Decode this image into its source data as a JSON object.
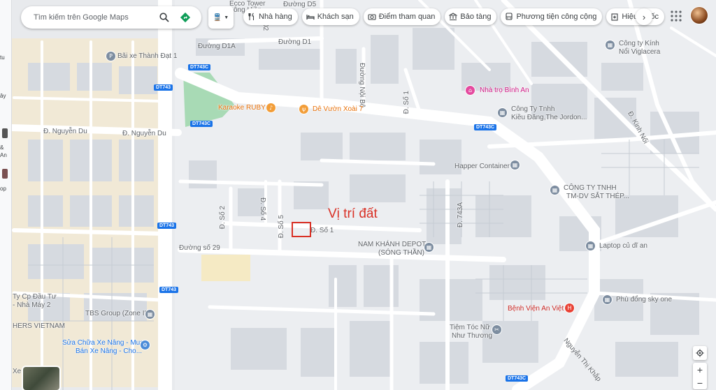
{
  "search": {
    "placeholder": "Tìm kiếm trên Google Maps"
  },
  "chips": [
    {
      "label": "Nhà hàng",
      "icon": "fork-knife-icon"
    },
    {
      "label": "Khách sạn",
      "icon": "bed-icon"
    },
    {
      "label": "Điểm tham quan",
      "icon": "camera-icon"
    },
    {
      "label": "Bảo tàng",
      "icon": "museum-icon"
    },
    {
      "label": "Phương tiện công cộng",
      "icon": "bus-icon"
    },
    {
      "label": "Hiệu thuốc",
      "icon": "pharmacy-icon"
    }
  ],
  "overlay": {
    "title": "Vị trí đất"
  },
  "left_strip_text": [
    "tu",
    "ây",
    "&",
    "An",
    "op"
  ],
  "streets": {
    "nguyen_du_1": "Đ. Nguyễn Du",
    "nguyen_du_2": "Đ. Nguyễn Du",
    "d1a": "Đường D1A",
    "d1": "Đường D1",
    "d5": "Đường D5",
    "d2": "02",
    "noi_bo": "Đường Nội Bộ",
    "so1_top": "Đ. Số 1",
    "so1": "Đ. Số 1",
    "so2": "Đ. Số 2",
    "so4": "Đ. Số 4",
    "so5": "Đ. Số 5",
    "so29": "Đường số 29",
    "d743a": "Đ. 743A",
    "kinh_noi": "Đ. Kinh Nối",
    "nguyen_thi_khap": "Nguyễn Thị Khắp"
  },
  "shields": {
    "dt743c_1": "DT743C",
    "dt743": "DT743",
    "dt743c_2": "DT743C",
    "dt743c_3": "DT743C",
    "dt743_2": "DT743",
    "dt743_3": "DT743",
    "dt743c_4": "DT743C"
  },
  "places": {
    "ecco_tower": "Ecco Tower",
    "cong_hien": "ông Hiền",
    "bai_xe": "Bãi xe Thành Đạt 1",
    "karaoke": "Karaoke RUBY",
    "de_vuon": "Dê Vườn Xoài 7",
    "nha_tro": "Nhà trọ Bình An",
    "kinh_noi_viglacera_1": "Công ty Kính",
    "kinh_noi_viglacera_2": "Nổi Viglacera",
    "kieu_dang_1": "Công Ty Tnhh",
    "kieu_dang_2": "Kiều Đăng,The Jordon...",
    "happer": "Happer Container",
    "sat_thep_1": "CÔNG TY TNHH",
    "sat_thep_2": "TM-DV SẮT THÉP...",
    "nam_khanh_1": "NAM KHÁNH DEPOT",
    "nam_khanh_2": "(SÓNG THẦN)",
    "laptop": "Laptop củ dĩ an",
    "phu_dong": "Phù đổng sky one",
    "benh_vien": "Bệnh Viện An Việt",
    "tiem_toc_1": "Tiệm Tóc Nữ",
    "tiem_toc_2": "Như Thương",
    "tbs": "TBS Group (Zone II)",
    "ty_cp_1": "Ty Cp Đầu Tư",
    "ty_cp_2": "- Nhà Máy 2",
    "hers": "HERS VIETNAM",
    "sua_chua_1": "Sửa Chữa Xe Nâng - Mua",
    "sua_chua_2": "Bán Xe Nâng - Cho...",
    "xe": "Xe"
  },
  "colors": {
    "accent": "#1a73e8",
    "overlay_red": "#d93025",
    "park": "#a8dab5",
    "road": "#ffffff",
    "block": "#d3d8de",
    "builtup": "#f1e9d6"
  }
}
